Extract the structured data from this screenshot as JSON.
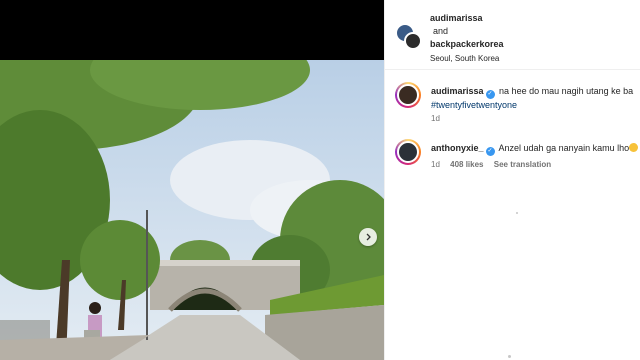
{
  "post": {
    "collaborators": [
      "audimarissa",
      "backpackerkorea"
    ],
    "and_text": "and",
    "location": "Seoul, South Korea"
  },
  "comments": [
    {
      "username": "audimarissa",
      "text": "na hee do mau nagih utang ke ba",
      "hashtag": "#twentyfivetwentyone",
      "time": "1d"
    },
    {
      "username": "anthonyxie_",
      "text": "Anzel udah ga nanyain kamu lho",
      "time": "1d",
      "likes": "408 likes",
      "see_translation": "See translation"
    }
  ],
  "icons": {
    "verified": "verified-badge-icon",
    "next": "chevron-right-icon",
    "emoji": "emoji-icon"
  },
  "colors": {
    "link": "#00376b",
    "verified": "#3897f0",
    "meta": "#737373"
  }
}
